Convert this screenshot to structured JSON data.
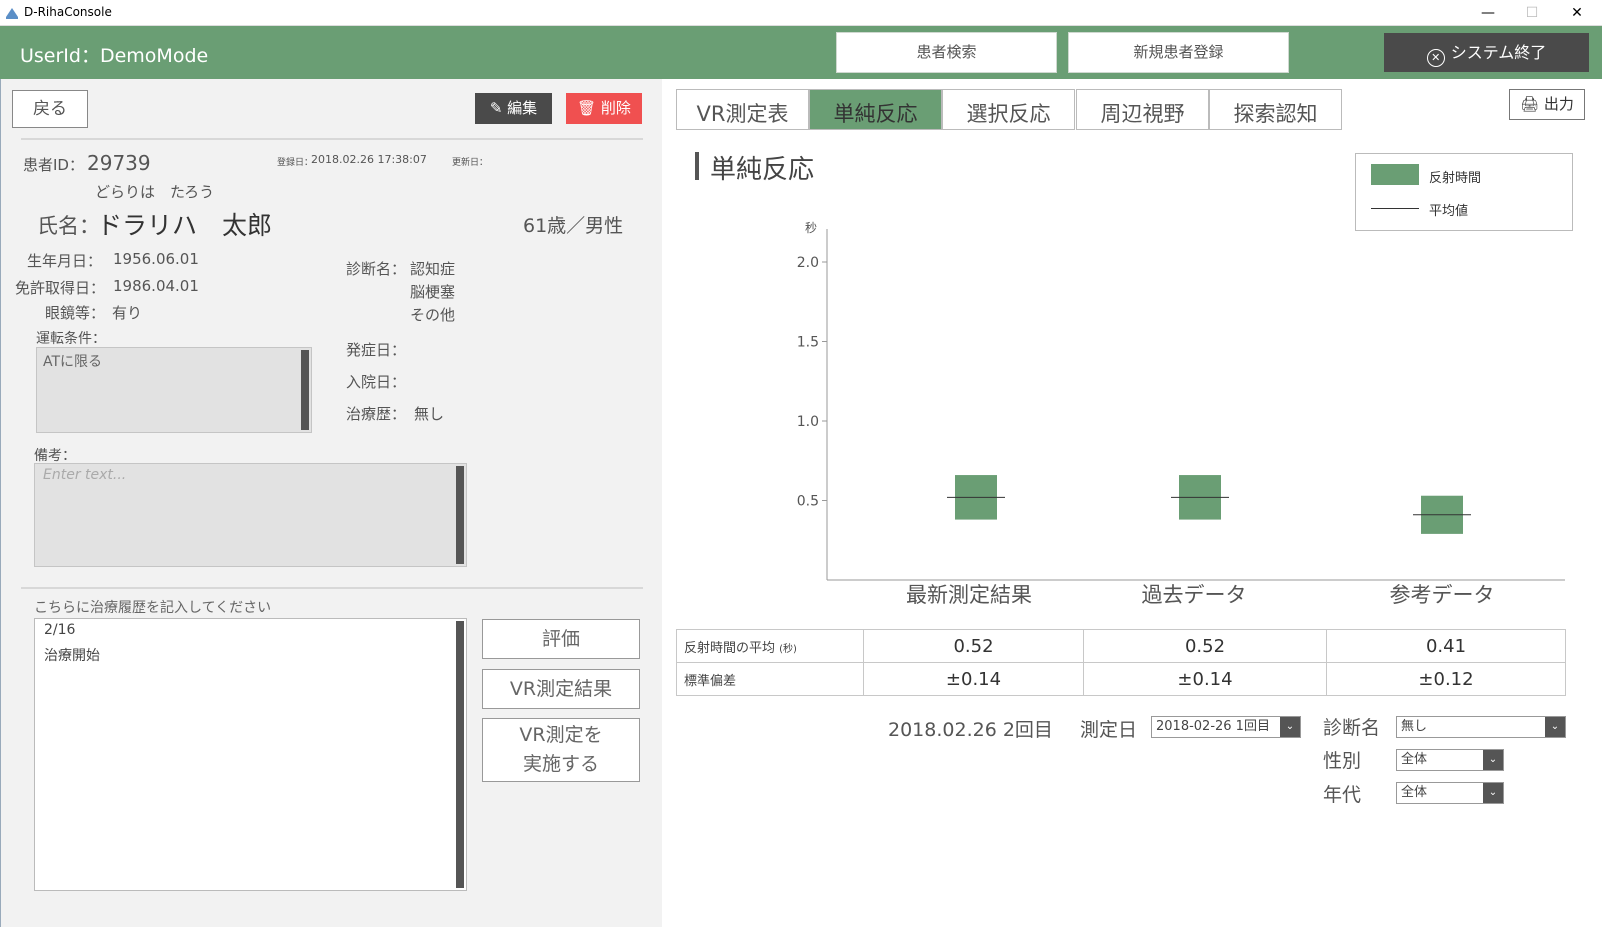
{
  "window": {
    "title": "D-RihaConsole",
    "minimize": "—",
    "maximize": "☐",
    "close": "✕"
  },
  "header": {
    "userid": "UserId：DemoMode",
    "search_btn": "患者検索",
    "register_btn": "新規患者登録",
    "exit_btn": "システム終了",
    "exit_icon": "ⓧ"
  },
  "left": {
    "back_btn": "戻る",
    "edit_btn": "編集",
    "delete_btn": "削除",
    "patient_id_label": "患者ID：",
    "patient_id": "29739",
    "registered_label": "登録日：",
    "registered_date": "2018.02.26 17:38:07",
    "updated_label": "更新日：",
    "furigana": "どらりは　たろう",
    "name_label": "氏名：",
    "name": "ドラリハ　太郎",
    "age_gender": "61歳／男性",
    "birth_label": "生年月日：",
    "birth": "1956.06.01",
    "license_label": "免許取得日：",
    "license": "1986.04.01",
    "glasses_label": "眼鏡等：",
    "glasses": "有り",
    "conditions_label": "運転条件：",
    "conditions_value": "ATに限る",
    "diagnosis_label": "診断名：",
    "diagnosis": [
      "認知症",
      "脳梗塞",
      "その他"
    ],
    "onset_label": "発症日：",
    "admission_label": "入院日：",
    "treatment_label": "治療歴：",
    "treatment": "無し",
    "notes_label": "備考：",
    "notes_placeholder": "Enter text...",
    "history_label": "こちらに治療履歴を記入してください",
    "history_lines": [
      "2/16",
      "治療開始"
    ],
    "eval_btn": "評価",
    "vr_result_btn": "VR測定結果",
    "vr_run_btn_line1": "VR測定を",
    "vr_run_btn_line2": "実施する"
  },
  "tabs": [
    {
      "label": "VR測定表",
      "active": false
    },
    {
      "label": "単純反応",
      "active": true
    },
    {
      "label": "選択反応",
      "active": false
    },
    {
      "label": "周辺視野",
      "active": false
    },
    {
      "label": "探索認知",
      "active": false
    }
  ],
  "print_btn": "出力",
  "section_title": "単純反応",
  "colors": {
    "accent": "#6a9e74",
    "delete": "#f05050",
    "dark": "#4a4a4a"
  },
  "chart_data": {
    "type": "bar",
    "ylabel": "秒",
    "yticks": [
      "0.5",
      "1.0",
      "1.5",
      "2.0"
    ],
    "ylim": [
      0,
      2.2
    ],
    "legend": [
      "反射時間",
      "平均値"
    ],
    "legend_position": "top-right",
    "categories": [
      "最新測定結果",
      "過去データ",
      "参考データ"
    ],
    "mean": [
      0.52,
      0.52,
      0.41
    ],
    "sd": [
      0.14,
      0.14,
      0.12
    ],
    "row_labels": [
      "反射時間の平均",
      "標準偏差"
    ],
    "row_label_unit": "(秒)",
    "means_text": [
      "0.52",
      "0.52",
      "0.41"
    ],
    "sd_text": [
      "±0.14",
      "±0.14",
      "±0.12"
    ]
  },
  "filters": {
    "measure_info": "2018.02.26 2回目",
    "date_label": "測定日",
    "date_value": "2018-02-26 1回目",
    "diag_label": "診断名",
    "diag_value": "無し",
    "gender_label": "性別",
    "gender_value": "全体",
    "age_label": "年代",
    "age_value": "全体"
  }
}
